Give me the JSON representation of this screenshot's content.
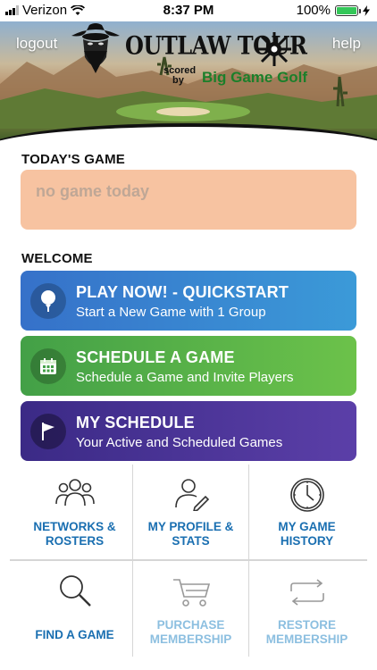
{
  "status_bar": {
    "carrier": "Verizon",
    "time": "8:37 PM",
    "battery_percent": "100%",
    "battery_level": 1.0,
    "battery_color": "#34c759"
  },
  "header": {
    "logout_label": "logout",
    "help_label": "help",
    "logo_title": "OUTLAW TOUR",
    "scored_line1": "scored",
    "scored_line2": "by",
    "brand": "Big Game Golf"
  },
  "today": {
    "section_title": "TODAY'S GAME",
    "empty_text": "no game today",
    "card_color": "#f7c3a1"
  },
  "welcome": {
    "section_title": "WELCOME",
    "actions": [
      {
        "title": "PLAY NOW! - QUICKSTART",
        "subtitle": "Start a New Game with 1 Group",
        "icon": "golf-ball-tee-icon"
      },
      {
        "title": "SCHEDULE A GAME",
        "subtitle": "Schedule a Game and Invite Players",
        "icon": "calendar-icon"
      },
      {
        "title": "MY SCHEDULE",
        "subtitle": "Your Active and Scheduled Games",
        "icon": "flag-icon"
      }
    ]
  },
  "menu": {
    "items": [
      {
        "line1": "NETWORKS &",
        "line2": "ROSTERS",
        "icon": "people-group-icon",
        "enabled": true
      },
      {
        "line1": "MY PROFILE &",
        "line2": "STATS",
        "icon": "profile-edit-icon",
        "enabled": true
      },
      {
        "line1": "MY GAME",
        "line2": "HISTORY",
        "icon": "clock-icon",
        "enabled": true
      },
      {
        "line1": "FIND A GAME",
        "line2": "",
        "icon": "magnifier-icon",
        "enabled": true
      },
      {
        "line1": "PURCHASE",
        "line2": "MEMBERSHIP",
        "icon": "cart-icon",
        "enabled": false
      },
      {
        "line1": "RESTORE",
        "line2": "MEMBERSHIP",
        "icon": "restore-arrows-icon",
        "enabled": false
      }
    ],
    "label_color": "#1a6fb1",
    "disabled_label_color": "#8cbfe0"
  }
}
